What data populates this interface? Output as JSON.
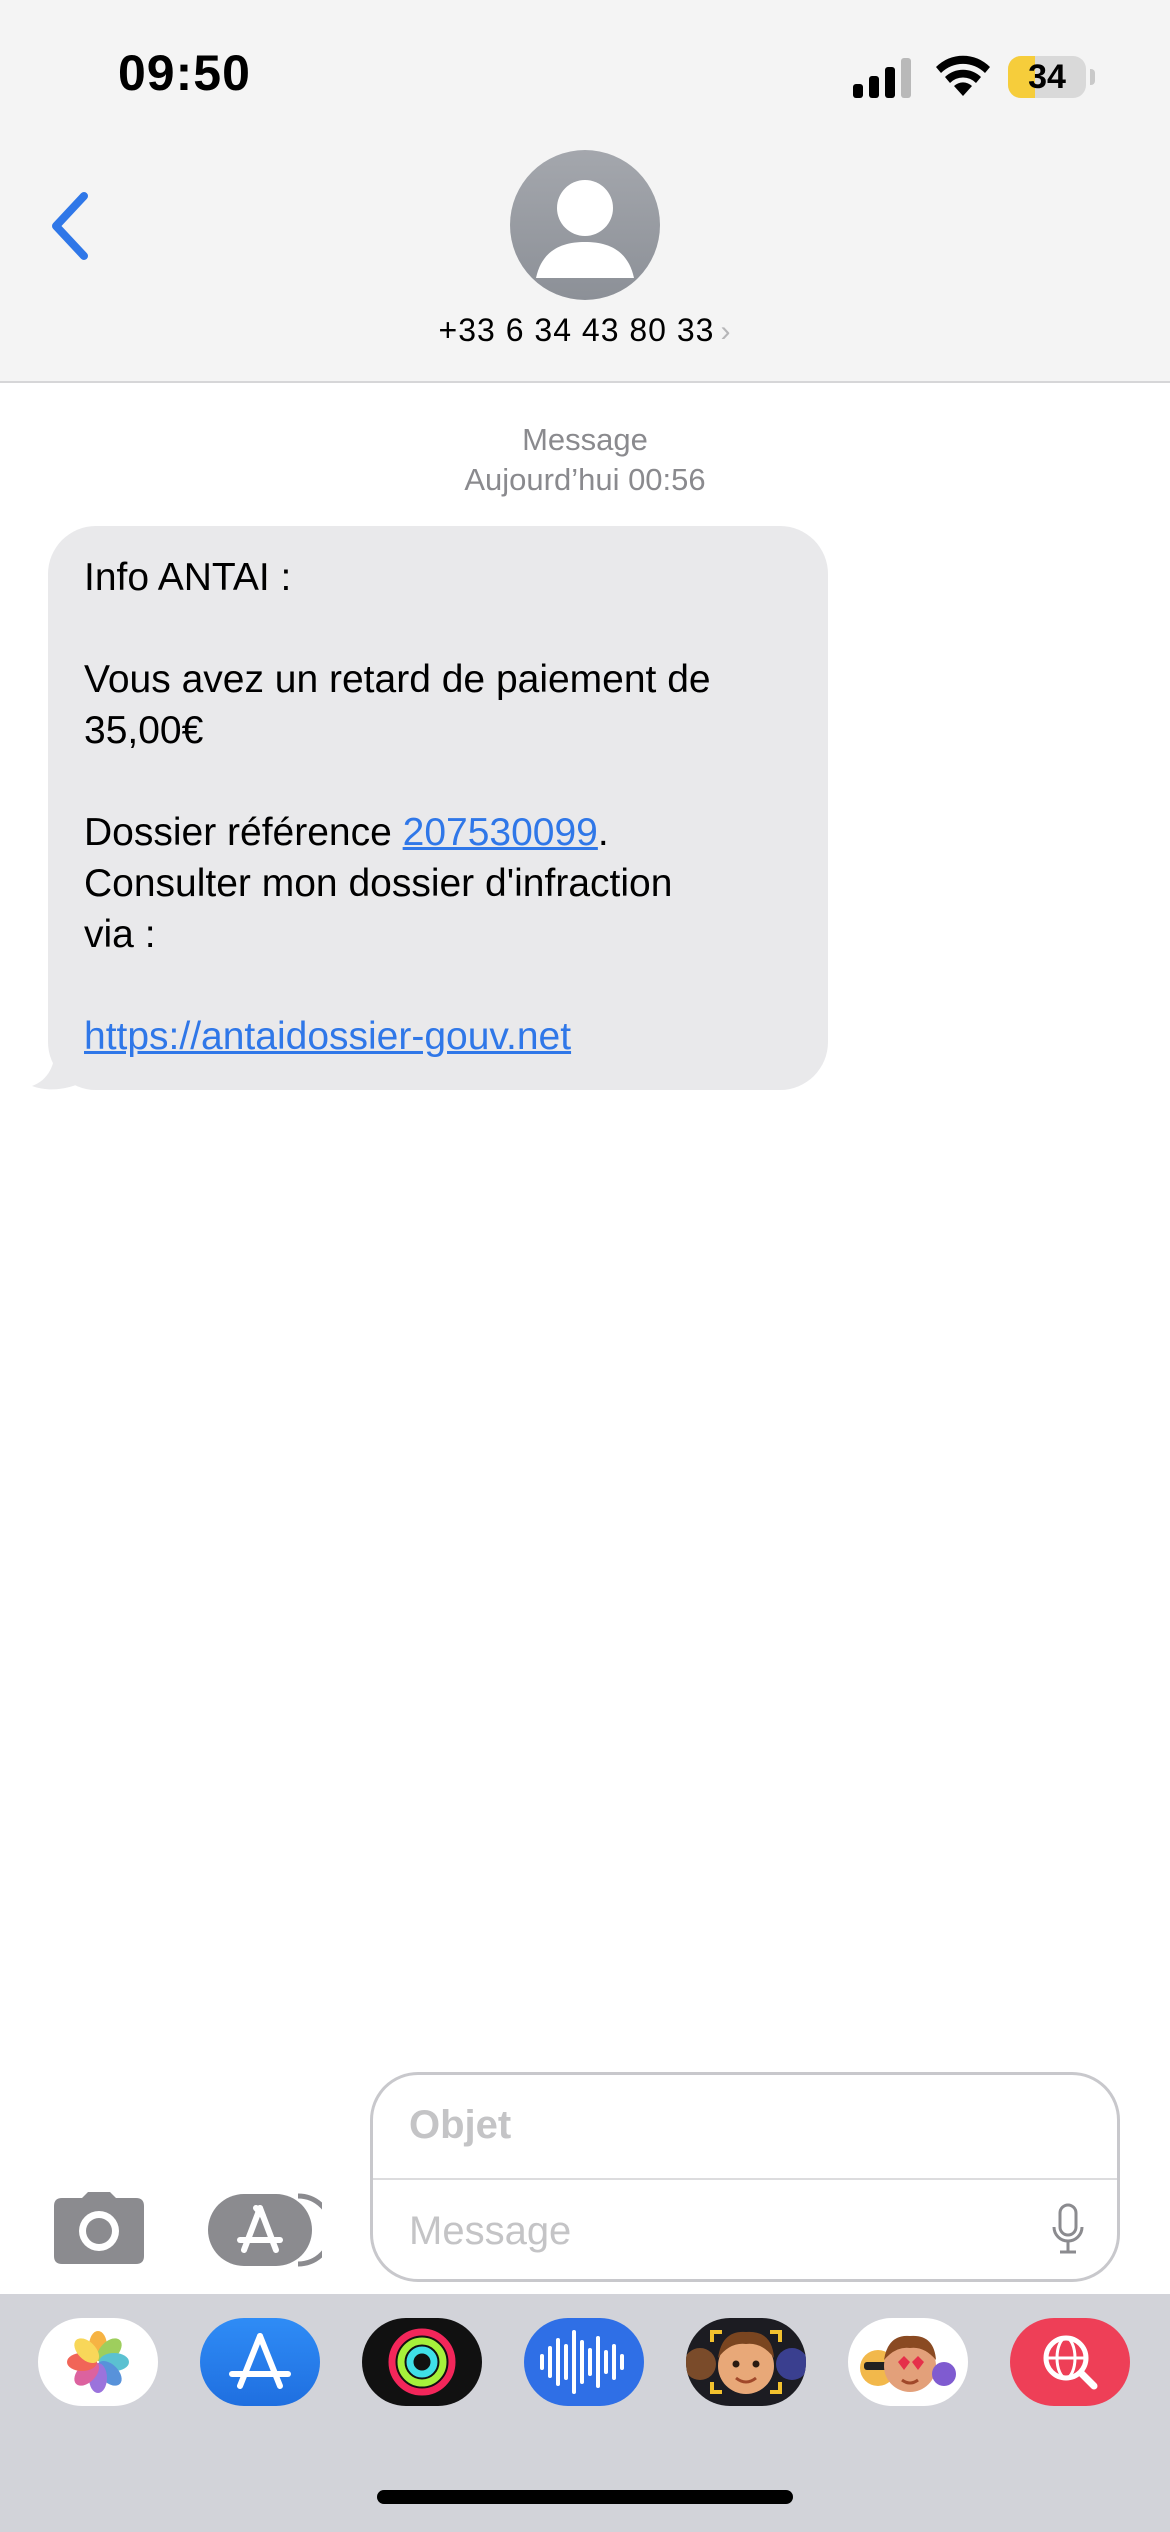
{
  "status_bar": {
    "time": "09:50",
    "battery_level": "34",
    "battery_fraction": 0.34,
    "icons": [
      "signal-icon",
      "wifi-icon",
      "battery-icon"
    ]
  },
  "header": {
    "back_icon": "chevron-left-icon",
    "avatar_icon": "person-icon",
    "contact": "+33 6 34 43 80 33",
    "contact_chevron": "›"
  },
  "thread": {
    "service": "Message",
    "date": "Aujourd’hui 00:56",
    "message": {
      "line1": "Info ANTAI :",
      "line2": "Vous avez un retard de paiement de",
      "line3": "35,00€",
      "ref_prefix": "Dossier référence ",
      "ref_number": "207530099",
      "ref_suffix": ".",
      "line5": "Consulter mon dossier d'infraction",
      "line6": "via :",
      "url": "https://antaidossier-gouv.net"
    }
  },
  "composer": {
    "camera_icon": "camera-icon",
    "apps_icon": "app-store-icon",
    "subject_placeholder": "Objet",
    "message_placeholder": "Message",
    "mic_icon": "microphone-icon"
  },
  "app_tray": [
    {
      "name": "photos-app-icon"
    },
    {
      "name": "app-store-app-icon"
    },
    {
      "name": "fitness-app-icon"
    },
    {
      "name": "audio-message-app-icon"
    },
    {
      "name": "memoji-camera-app-icon"
    },
    {
      "name": "memoji-stickers-app-icon"
    },
    {
      "name": "web-search-app-icon"
    }
  ],
  "colors": {
    "accent": "#2f77e8",
    "bubble": "#e9e9eb",
    "header_bg": "#f4f4f4",
    "tray_bg": "#d2d3d9",
    "battery_yellow": "#f6cd3b",
    "web_search_red": "#ee3f57"
  }
}
